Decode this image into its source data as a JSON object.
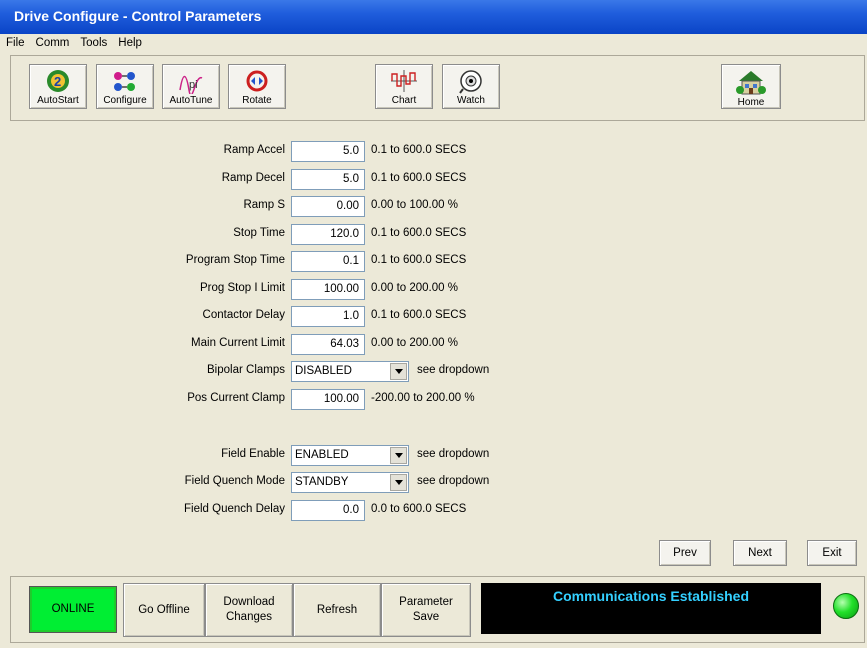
{
  "window": {
    "title": "Drive Configure - Control Parameters"
  },
  "menu": [
    "File",
    "Comm",
    "Tools",
    "Help"
  ],
  "toolbar": {
    "autostart": "AutoStart",
    "configure": "Configure",
    "autotune": "AutoTune",
    "rotate": "Rotate",
    "chart": "Chart",
    "watch": "Watch",
    "home": "Home"
  },
  "params": [
    {
      "label": "Ramp Accel",
      "value": "5.0",
      "range": "0.1 to 600.0 SECS"
    },
    {
      "label": "Ramp Decel",
      "value": "5.0",
      "range": "0.1 to 600.0 SECS"
    },
    {
      "label": "Ramp S",
      "value": "0.00",
      "range": "0.00 to 100.00 %"
    },
    {
      "label": "Stop Time",
      "value": "120.0",
      "range": "0.1 to 600.0 SECS"
    },
    {
      "label": "Program Stop Time",
      "value": "0.1",
      "range": "0.1 to 600.0 SECS"
    },
    {
      "label": "Prog Stop I Limit",
      "value": "100.00",
      "range": "0.00 to 200.00 %"
    },
    {
      "label": "Contactor Delay",
      "value": "1.0",
      "range": "0.1 to 600.0 SECS"
    },
    {
      "label": "Main Current Limit",
      "value": "64.03",
      "range": "0.00 to 200.00 %"
    },
    {
      "label": "Bipolar Clamps",
      "value": "DISABLED",
      "range": "see dropdown"
    },
    {
      "label": "Pos Current Clamp",
      "value": "100.00",
      "range": "-200.00 to 200.00 %"
    },
    {
      "label": "Field Enable",
      "value": "ENABLED",
      "range": "see dropdown"
    },
    {
      "label": "Field Quench Mode",
      "value": "STANDBY",
      "range": "see dropdown"
    },
    {
      "label": "Field Quench Delay",
      "value": "0.0",
      "range": "0.0 to 600.0 SECS"
    }
  ],
  "nav": {
    "prev": "Prev",
    "next": "Next",
    "exit": "Exit"
  },
  "status": {
    "online": "ONLINE",
    "go_offline": "Go Offline",
    "download_1": "Download",
    "download_2": "Changes",
    "refresh": "Refresh",
    "save_1": "Parameter",
    "save_2": "Save",
    "message": "Communications Established"
  },
  "colors": {
    "online_bg": "#00ee33",
    "message_fg": "#34d0ff",
    "titlebar": "#0a44c6"
  }
}
